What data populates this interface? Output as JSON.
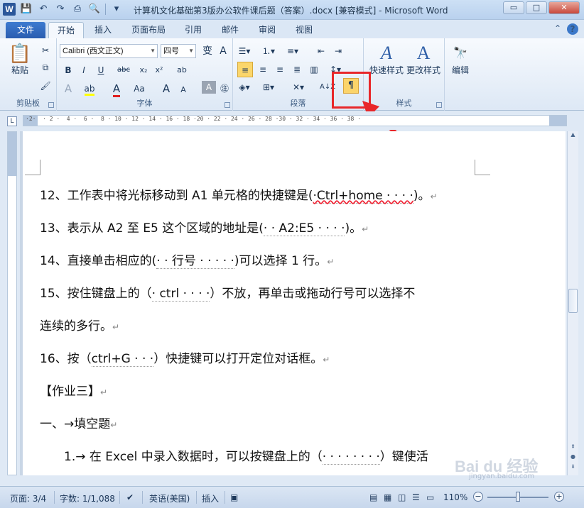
{
  "window": {
    "title": "计算机文化基础第3版办公软件课后题（答案）.docx [兼容模式] - Microsoft Word",
    "controls": [
      "▭",
      "□",
      "✕"
    ]
  },
  "tabs": [
    {
      "label": "文件"
    },
    {
      "label": "开始"
    },
    {
      "label": "插入"
    },
    {
      "label": "页面布局"
    },
    {
      "label": "引用"
    },
    {
      "label": "邮件"
    },
    {
      "label": "审阅"
    },
    {
      "label": "视图"
    }
  ],
  "ribbon": {
    "clipboard": {
      "paste": "粘贴",
      "label": "剪贴板"
    },
    "font": {
      "name": "Calibri (西文正文)",
      "size": "四号",
      "label": "字体",
      "buttons": [
        "B",
        "I",
        "U",
        "abc",
        "x₂",
        "x²",
        "A",
        "Aa",
        "A",
        "A"
      ]
    },
    "paragraph": {
      "label": "段落"
    },
    "styles": {
      "quick": "快速样式",
      "change": "更改样式",
      "label": "样式"
    },
    "editing": {
      "label": "编辑"
    }
  },
  "document": {
    "lines": [
      {
        "prefix": "12、工作表中将光标移动到 A1 单元格的快捷键是(",
        "answer": "·Ctrl+home · · · ·",
        "suffix": ")。"
      },
      {
        "prefix": "13、表示从 A2 至 E5 这个区域的地址是(",
        "answer": "· · A2:E5 · · · ·",
        "suffix": ")。"
      },
      {
        "prefix": "14、直接单击相应的(",
        "answer": "· · 行号 · · · · ·",
        "suffix": ")可以选择 1 行。"
      },
      {
        "prefix": "15、按住键盘上的（",
        "answer": "· ctrl · · · ·",
        "suffix": "）不放，再单击或拖动行号可以选择不"
      },
      {
        "prefix": "连续的多行。",
        "answer": "",
        "suffix": ""
      },
      {
        "prefix": "16、按（",
        "answer": "ctrl+G · · ·",
        "suffix": "）快捷键可以打开定位对话框。"
      },
      {
        "prefix": "【作业三】",
        "answer": "",
        "suffix": ""
      },
      {
        "prefix": "一、→填空题",
        "answer": "",
        "suffix": ""
      },
      {
        "prefix": "1.→ 在 Excel 中录入数据时，可以按键盘上的（",
        "answer": "· · · · · · · ·",
        "suffix": "）键使活"
      }
    ]
  },
  "statusbar": {
    "page": "页面: 3/4",
    "words": "字数: 1/1,088",
    "language": "英语(美国)",
    "mode": "插入",
    "zoom": "110%"
  },
  "watermark": "Bai du 经验",
  "watermark_sub": "jingyan.baidu.com"
}
